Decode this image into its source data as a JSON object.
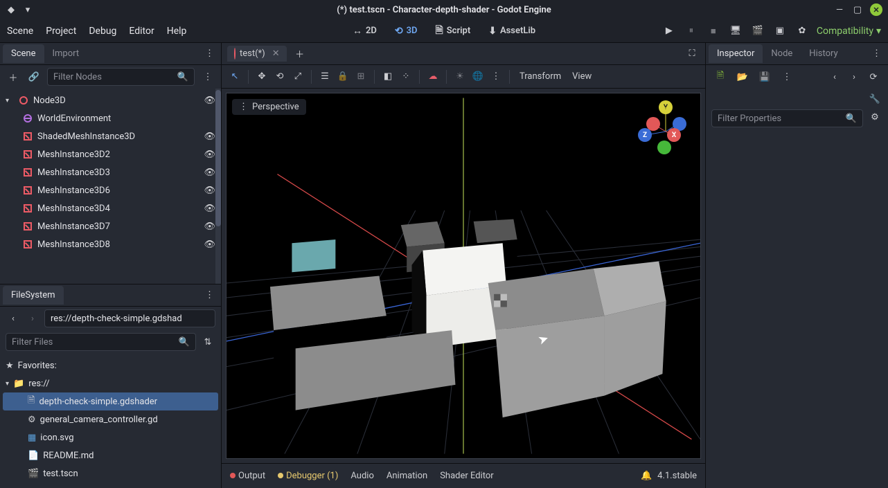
{
  "window": {
    "title": "(*) test.tscn - Character-depth-shader - Godot Engine"
  },
  "menu": {
    "scene": "Scene",
    "project": "Project",
    "debug": "Debug",
    "editor": "Editor",
    "help": "Help"
  },
  "workspaces": {
    "d2": "2D",
    "d3": "3D",
    "script": "Script",
    "assetlib": "AssetLib"
  },
  "renderer": "Compatibility",
  "left_tabs": {
    "scene": "Scene",
    "import": "Import"
  },
  "scene_filter": {
    "placeholder": "Filter Nodes"
  },
  "tree": {
    "root": "Node3D",
    "children": [
      "WorldEnvironment",
      "ShadedMeshInstance3D",
      "MeshInstance3D2",
      "MeshInstance3D3",
      "MeshInstance3D6",
      "MeshInstance3D4",
      "MeshInstance3D7",
      "MeshInstance3D8"
    ]
  },
  "filesystem": {
    "title": "FileSystem",
    "path": "res://depth-check-simple.gdshad",
    "filter_placeholder": "Filter Files",
    "favorites": "Favorites:",
    "root": "res://",
    "files": [
      {
        "name": "depth-check-simple.gdshader",
        "selected": true
      },
      {
        "name": "general_camera_controller.gd",
        "selected": false
      },
      {
        "name": "icon.svg",
        "selected": false
      },
      {
        "name": "README.md",
        "selected": false
      },
      {
        "name": "test.tscn",
        "selected": false
      }
    ]
  },
  "scene_tab": "test(*)",
  "viewport": {
    "transform": "Transform",
    "view": "View",
    "perspective": "Perspective"
  },
  "bottom": {
    "output": "Output",
    "debugger": "Debugger (1)",
    "audio": "Audio",
    "animation": "Animation",
    "shader": "Shader Editor",
    "version": "4.1.stable"
  },
  "inspector_tabs": {
    "inspector": "Inspector",
    "node": "Node",
    "history": "History"
  },
  "inspector": {
    "filter_placeholder": "Filter Properties"
  }
}
